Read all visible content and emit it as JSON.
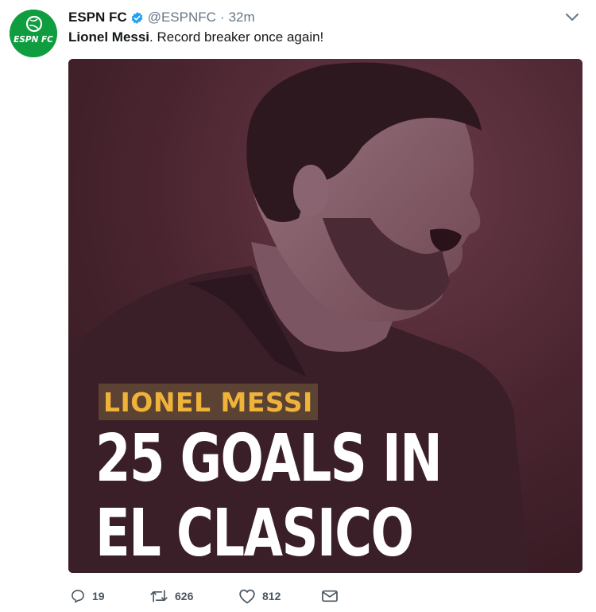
{
  "account": {
    "display_name": "ESPN FC",
    "handle": "@ESPNFC",
    "separator": "·",
    "timestamp": "32m",
    "verified": true,
    "avatar_text": "ESPN FC"
  },
  "tweet": {
    "text_bold": "Lionel Messi",
    "text_rest": ". Record breaker once again!"
  },
  "media": {
    "banner": "LIONEL MESSI",
    "headline_lines": [
      "25 GOALS IN",
      "EL CLASICO"
    ],
    "colors": {
      "tint": "#4a2530",
      "banner_bg": "#5b4232",
      "banner_text": "#f0b33a"
    }
  },
  "actions": {
    "replies": "19",
    "retweets": "626",
    "likes": "812"
  },
  "colors": {
    "brand_green": "#0f9d3f",
    "verified_blue": "#1da1f2",
    "muted": "#657786"
  }
}
